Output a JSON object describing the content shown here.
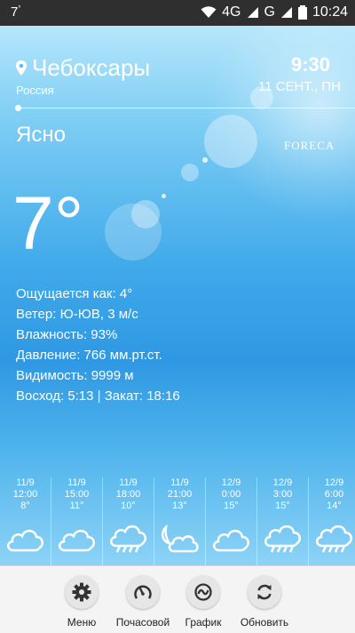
{
  "status_bar": {
    "time_left": "7",
    "time_left_sup": "°",
    "network": "4G",
    "network2": "G",
    "battery": "97",
    "clock": "10:24"
  },
  "location": {
    "city": "Чебоксары",
    "country": "Россия"
  },
  "local_time": {
    "time": "9:30",
    "date": "11 СЕНТ., ПН"
  },
  "condition": "Ясно",
  "brand": "FORECA",
  "temperature": "7°",
  "details": [
    "Ощущается как: 4°",
    "Ветер: Ю-ЮВ, 3 м/с",
    "Влажность: 93%",
    "Давление: 766 мм.рт.ст.",
    "Видимость: 9999 м",
    "Восход: 5:13 | Закат: 18:16"
  ],
  "forecast": [
    {
      "date": "11/9",
      "time": "12:00",
      "temp": "8°",
      "icon": "cloud-icon"
    },
    {
      "date": "11/9",
      "time": "15:00",
      "temp": "11°",
      "icon": "cloud-icon"
    },
    {
      "date": "11/9",
      "time": "18:00",
      "temp": "10°",
      "icon": "cloud-rain-icon"
    },
    {
      "date": "11/9",
      "time": "21:00",
      "temp": "13°",
      "icon": "moon-cloud-icon"
    },
    {
      "date": "12/9",
      "time": "0:00",
      "temp": "15°",
      "icon": "cloud-icon"
    },
    {
      "date": "12/9",
      "time": "3:00",
      "temp": "15°",
      "icon": "cloud-rain-icon"
    },
    {
      "date": "12/9",
      "time": "6:00",
      "temp": "14°",
      "icon": "cloud-rain-icon"
    }
  ],
  "toolbar": [
    {
      "label": "Меню",
      "icon": "gear-icon"
    },
    {
      "label": "Почасовой",
      "icon": "gauge-icon"
    },
    {
      "label": "График",
      "icon": "chart-icon"
    },
    {
      "label": "Обновить",
      "icon": "refresh-icon"
    }
  ]
}
